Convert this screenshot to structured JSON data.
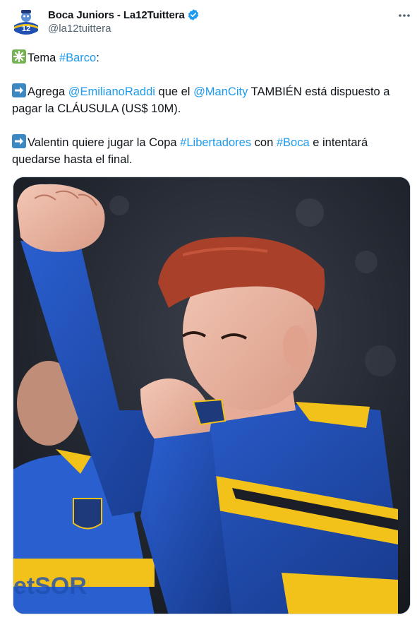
{
  "author": {
    "display_name": "Boca Juniors - La12Tuittera",
    "handle": "@la12tuittera",
    "verified": true,
    "avatar_icon": "la12-mascot-avatar",
    "avatar_text": "12"
  },
  "tweet": {
    "line1": {
      "emoji": "sparkle-emoji",
      "text": "Tema ",
      "hashtag": "#Barco",
      "after": ":"
    },
    "line2": {
      "emoji": "right-arrow-emoji",
      "text1": "Agrega ",
      "mention1": "@EmilianoRaddi",
      "text2": " que el ",
      "mention2": "@ManCity",
      "text3": " TAMBIÉN está dispuesto a pagar la CLÁUSULA (US$ 10M)."
    },
    "line3": {
      "emoji": "right-arrow-emoji",
      "text1": "Valentin quiere jugar la Copa ",
      "hashtag1": "#Libertadores",
      "text2": " con ",
      "hashtag2": "#Boca",
      "text3": " e intentará quedarse hasta el final."
    }
  },
  "media": {
    "subject": "football-player-kissing-boca-shirt-crest",
    "background_player_shirt_text": "etSOR"
  },
  "colors": {
    "link": "#1d9bf0",
    "handle": "#536471",
    "verified": "#1d9bf0",
    "boca_blue": "#1f4fb0",
    "boca_yellow": "#f2c21b"
  }
}
